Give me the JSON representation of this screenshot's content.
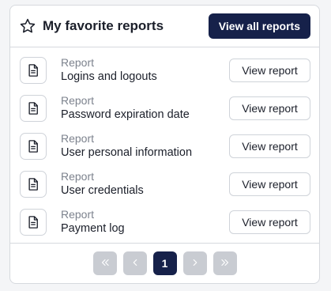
{
  "header": {
    "title": "My favorite reports",
    "view_all_label": "View all reports",
    "icon": "star-outline-icon"
  },
  "reports": [
    {
      "type": "Report",
      "name": "Logins and logouts",
      "button": "View report"
    },
    {
      "type": "Report",
      "name": "Password expiration date",
      "button": "View report"
    },
    {
      "type": "Report",
      "name": "User personal information",
      "button": "View report"
    },
    {
      "type": "Report",
      "name": "User credentials",
      "button": "View report"
    },
    {
      "type": "Report",
      "name": "Payment log",
      "button": "View report"
    }
  ],
  "pagination": {
    "current_page": "1",
    "first_icon": "chevrons-left-icon",
    "prev_icon": "chevron-left-icon",
    "next_icon": "chevron-right-icon",
    "last_icon": "chevrons-right-icon"
  },
  "colors": {
    "primary": "#16214a",
    "pager_disabled": "#c9ccd2",
    "border": "#d6d9de",
    "muted_text": "#7c828d"
  }
}
